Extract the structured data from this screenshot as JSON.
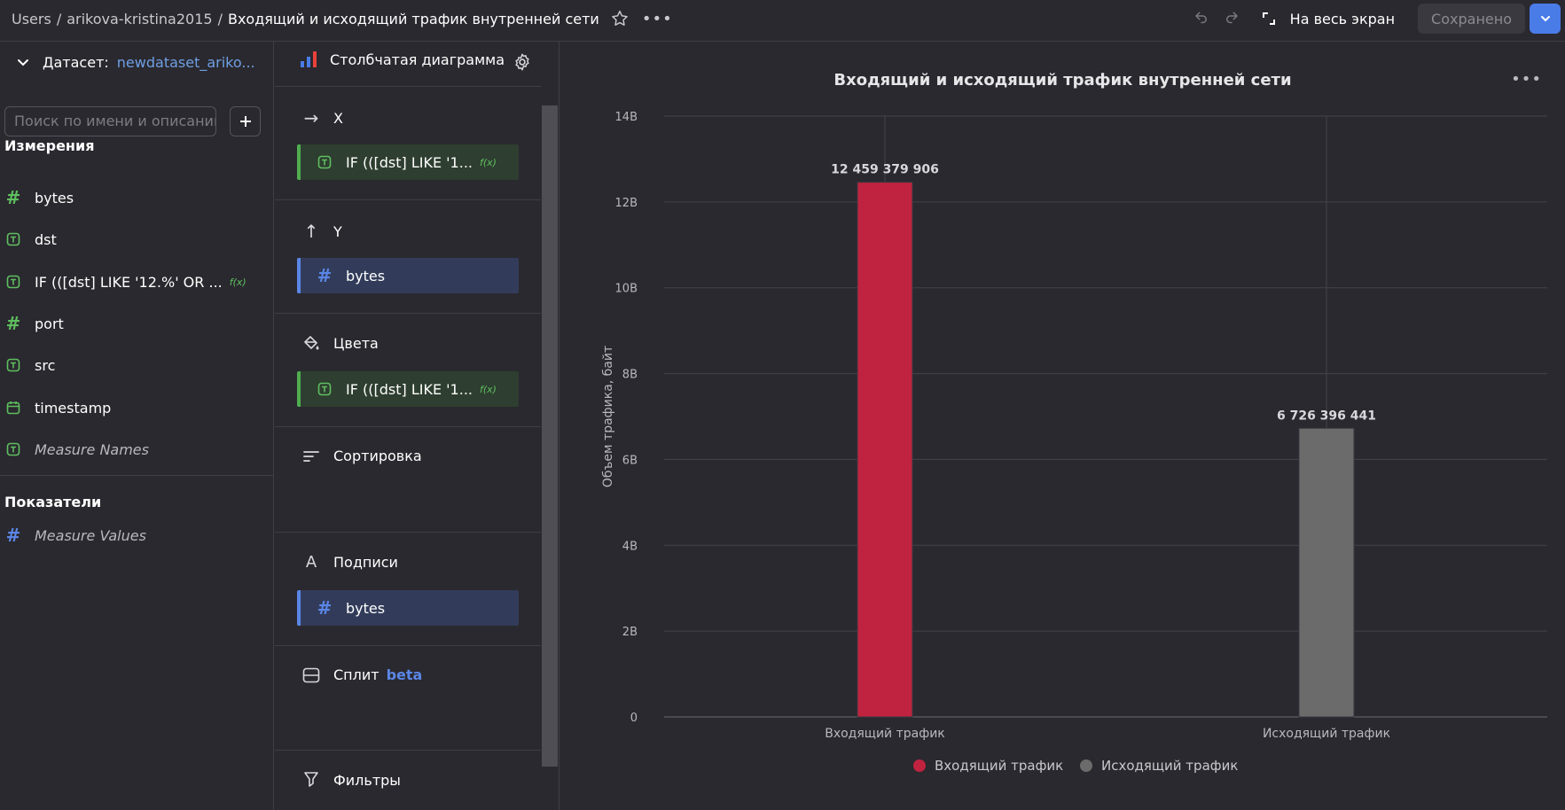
{
  "header": {
    "breadcrumbs": [
      "Users",
      "arikova-kristina2015"
    ],
    "current_title": "Входящий и исходящий трафик внутренней сети",
    "fullscreen_label": "На весь экран",
    "saved_label": "Сохранено"
  },
  "left_panel": {
    "dataset_label": "Датасет:",
    "dataset_name": "newdataset_ariko...",
    "search_placeholder": "Поиск по имени и описанию",
    "dimensions_title": "Измерения",
    "dimensions": [
      {
        "name": "bytes",
        "icon": "hash-icon"
      },
      {
        "name": "dst",
        "icon": "text-type-icon"
      },
      {
        "name": "IF (([dst] LIKE '12.%' OR ...",
        "icon": "text-type-icon",
        "formula": true
      },
      {
        "name": "port",
        "icon": "hash-icon"
      },
      {
        "name": "src",
        "icon": "text-type-icon"
      },
      {
        "name": "timestamp",
        "icon": "calendar-icon"
      },
      {
        "name": "Measure Names",
        "icon": "text-type-icon",
        "italic": true
      }
    ],
    "measures_title": "Показатели",
    "measures": [
      {
        "name": "Measure Values",
        "icon": "hash-icon",
        "italic": true
      }
    ]
  },
  "config_panel": {
    "chart_type_label": "Столбчатая диаграмма",
    "x_label": "X",
    "x_field": "IF (([dst] LIKE '1...",
    "y_label": "Y",
    "y_field": "bytes",
    "colors_label": "Цвета",
    "colors_field": "IF (([dst] LIKE '1...",
    "sort_label": "Сортировка",
    "labels_label": "Подписи",
    "labels_field": "bytes",
    "split_label": "Сплит",
    "split_badge": "beta",
    "filters_label": "Фильтры",
    "formula_badge": "f(x)"
  },
  "chart_data": {
    "type": "bar",
    "title": "Входящий и исходящий трафик внутренней сети",
    "ylabel": "Объем трафика, байт",
    "xlabel": "",
    "categories": [
      "Входящий трафик",
      "Исходящий трафик"
    ],
    "values": [
      12459379906,
      6726396441
    ],
    "data_labels": [
      "12 459 379 906",
      "6 726 396 441"
    ],
    "colors": [
      "#c0233f",
      "#6b6b6b"
    ],
    "ylim": [
      0,
      14000000000
    ],
    "yticks": [
      0,
      2000000000,
      4000000000,
      6000000000,
      8000000000,
      10000000000,
      12000000000,
      14000000000
    ],
    "ytick_labels": [
      "0",
      "2B",
      "4B",
      "6B",
      "8B",
      "10B",
      "12B",
      "14B"
    ],
    "legend": [
      {
        "name": "Входящий трафик",
        "color": "#c0233f"
      },
      {
        "name": "Исходящий трафик",
        "color": "#6b6b6b"
      }
    ],
    "legend_position": "bottom",
    "grid": true
  }
}
